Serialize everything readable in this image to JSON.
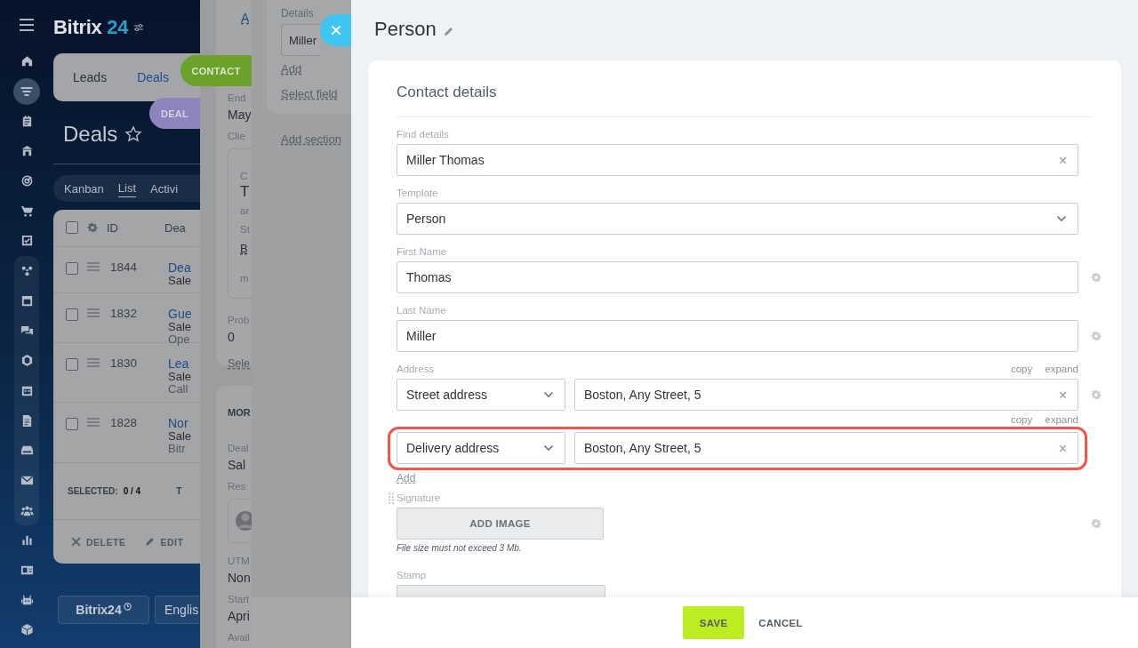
{
  "app": {
    "logo": {
      "name": "Bitrix",
      "number": "24"
    },
    "top_tabs": [
      {
        "label": "Leads",
        "selected": false
      },
      {
        "label": "Deals",
        "selected": true
      }
    ],
    "page_title": "Deals",
    "view_tabs": [
      {
        "label": "Kanban",
        "selected": false
      },
      {
        "label": "List",
        "selected": true
      },
      {
        "label": "Activi",
        "selected": false
      }
    ],
    "table": {
      "columns": [
        "ID",
        "Dea"
      ],
      "header_checked": false,
      "rows": [
        {
          "id": "1844",
          "checked": false,
          "title": "Dea",
          "lines": [
            "Sale"
          ]
        },
        {
          "id": "1832",
          "checked": false,
          "title": "Gue",
          "lines": [
            "Sale",
            "Ope"
          ]
        },
        {
          "id": "1830",
          "checked": false,
          "title": "Lea",
          "lines": [
            "Sale",
            "Call"
          ]
        },
        {
          "id": "1828",
          "checked": false,
          "title": "Nor",
          "lines": [
            "Sale",
            "Bitr"
          ]
        }
      ],
      "selected_label": "SELECTED:",
      "selected_count": "0 / 4",
      "footer_text_2": "T",
      "actions": [
        "DELETE",
        "EDIT"
      ]
    },
    "bottom_buttons": [
      "Bitrix24",
      "Englis"
    ]
  },
  "deal_panel": {
    "pill": "DEAL",
    "cards": [
      {
        "items": [
          {
            "kind": "link",
            "text": "A"
          },
          {
            "kind": "label",
            "text": "End"
          },
          {
            "kind": "value",
            "text": "May"
          },
          {
            "kind": "label",
            "text": "Clie"
          },
          {
            "kind": "box",
            "items": [
              {
                "kind": "label",
                "text": "C"
              },
              {
                "kind": "big",
                "text": "T"
              },
              {
                "kind": "small",
                "text": "ar"
              },
              {
                "kind": "small",
                "text": "St"
              },
              {
                "kind": "link",
                "text": "B"
              },
              {
                "kind": "small",
                "text": "m"
              }
            ]
          },
          {
            "kind": "label",
            "text": "Prob"
          },
          {
            "kind": "value",
            "text": "0"
          },
          {
            "kind": "dashed",
            "text": "Sele"
          }
        ]
      },
      {
        "items": [
          {
            "kind": "heading",
            "text": "MOR"
          },
          {
            "kind": "label",
            "text": "Deal"
          },
          {
            "kind": "value",
            "text": "Sal"
          },
          {
            "kind": "label",
            "text": "Res"
          },
          {
            "kind": "avatar"
          },
          {
            "kind": "label",
            "text": "UTM"
          },
          {
            "kind": "value",
            "text": "Non"
          },
          {
            "kind": "label",
            "text": "Start"
          },
          {
            "kind": "value",
            "text": "Apri"
          },
          {
            "kind": "label",
            "text": "Avail"
          }
        ]
      }
    ]
  },
  "contact_panel": {
    "pill": "CONTACT",
    "details_label": "Details",
    "details_value": "Miller",
    "links": [
      "Add",
      "Select field"
    ],
    "add_section": "Add section"
  },
  "person": {
    "title": "Person",
    "section_title": "Contact details",
    "fields": [
      {
        "kind": "input",
        "label": "Find details",
        "value": "Miller Thomas",
        "clearable": true,
        "settings": false
      },
      {
        "kind": "select",
        "label": "Template",
        "value": "Person",
        "clearable": false,
        "settings": false
      },
      {
        "kind": "input",
        "label": "First Name",
        "value": "Thomas",
        "clearable": false,
        "settings": true
      },
      {
        "kind": "input",
        "label": "Last Name",
        "value": "Miller",
        "clearable": false,
        "settings": true
      }
    ],
    "address": {
      "label": "Address",
      "rows": [
        {
          "type": "Street address",
          "value": "Boston, Any Street, 5",
          "copy": "copy",
          "expand": "expand",
          "settings": true,
          "highlighted": false
        },
        {
          "type": "Delivery address",
          "value": "Boston, Any Street, 5",
          "copy": "copy",
          "expand": "expand",
          "settings": false,
          "highlighted": true
        }
      ],
      "add": "Add"
    },
    "signature": {
      "label": "Signature",
      "button": "ADD IMAGE",
      "note": "File size must not exceed 3 Mb.",
      "settings": true
    },
    "stamp": {
      "label": "Stamp"
    },
    "footer": [
      {
        "kind": "primary",
        "label": "SAVE"
      },
      {
        "kind": "link",
        "label": "CANCEL"
      }
    ]
  }
}
